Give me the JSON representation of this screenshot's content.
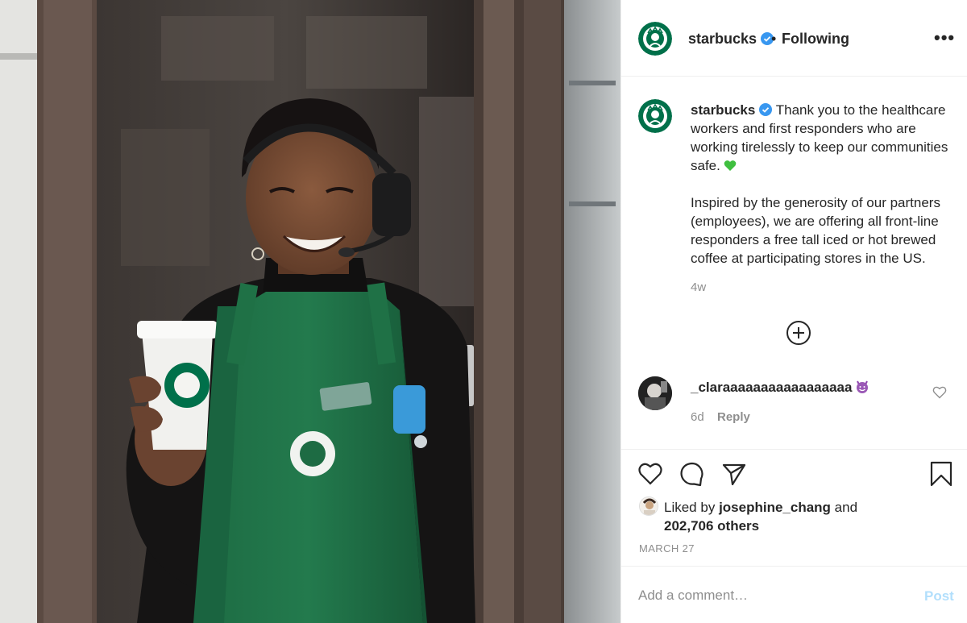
{
  "post": {
    "image_alt": "",
    "author": {
      "username": "starbucks",
      "verified": true,
      "follow_status": "Following",
      "separator": "•"
    },
    "more_options": "•••",
    "caption": {
      "username": "starbucks",
      "line1": "Thank you to the healthcare workers and first responders who are working tirelessly to keep our communities safe.",
      "line2": "Inspired by the generosity of our partners (employees), we are offering all front-line responders a free tall iced or hot brewed coffee at participating stores in the US.",
      "age": "4w"
    },
    "comments": [
      {
        "username": "_claraaaaaaaaaaaaaaaaa",
        "age": "6d",
        "reply_label": "Reply"
      }
    ],
    "likes": {
      "prefix": "Liked by",
      "liker": "josephine_chang",
      "connector": "and",
      "others": "202,706 others"
    },
    "date": "MARCH 27",
    "add_comment": {
      "placeholder": "Add a comment…",
      "post_label": "Post"
    },
    "icons": {
      "verified": "verified-badge-icon",
      "like": "heart-icon",
      "comment": "speech-bubble-icon",
      "share": "paper-plane-icon",
      "save": "bookmark-icon",
      "load_more": "plus-circle-icon",
      "comment_like": "small-heart-icon",
      "caption_emoji": "green-heart-icon",
      "comment_emoji": "smiling-devil-icon"
    },
    "colors": {
      "brand_green": "#00704A",
      "verified_blue": "#3897F0",
      "post_disabled": "#B2DFFC",
      "muted_text": "#8E8E8E"
    }
  }
}
